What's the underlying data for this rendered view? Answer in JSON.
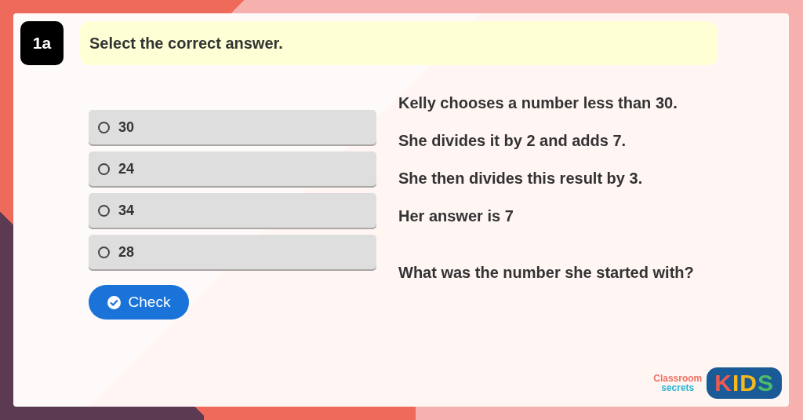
{
  "question": {
    "number": "1a",
    "prompt": "Select the correct answer."
  },
  "options": [
    {
      "label": "30",
      "selected": false
    },
    {
      "label": "24",
      "selected": false
    },
    {
      "label": "34",
      "selected": false
    },
    {
      "label": "28",
      "selected": false
    }
  ],
  "check_button": {
    "label": "Check"
  },
  "problem": [
    "Kelly chooses a number less than 30.",
    "She divides it by 2 and adds 7.",
    "She then divides this result by 3.",
    "Her answer is 7"
  ],
  "final_question": "What was the number she started with?",
  "logo": {
    "brand_top": "Classroom",
    "brand_bottom": "secrets",
    "kids": "KIDS"
  }
}
